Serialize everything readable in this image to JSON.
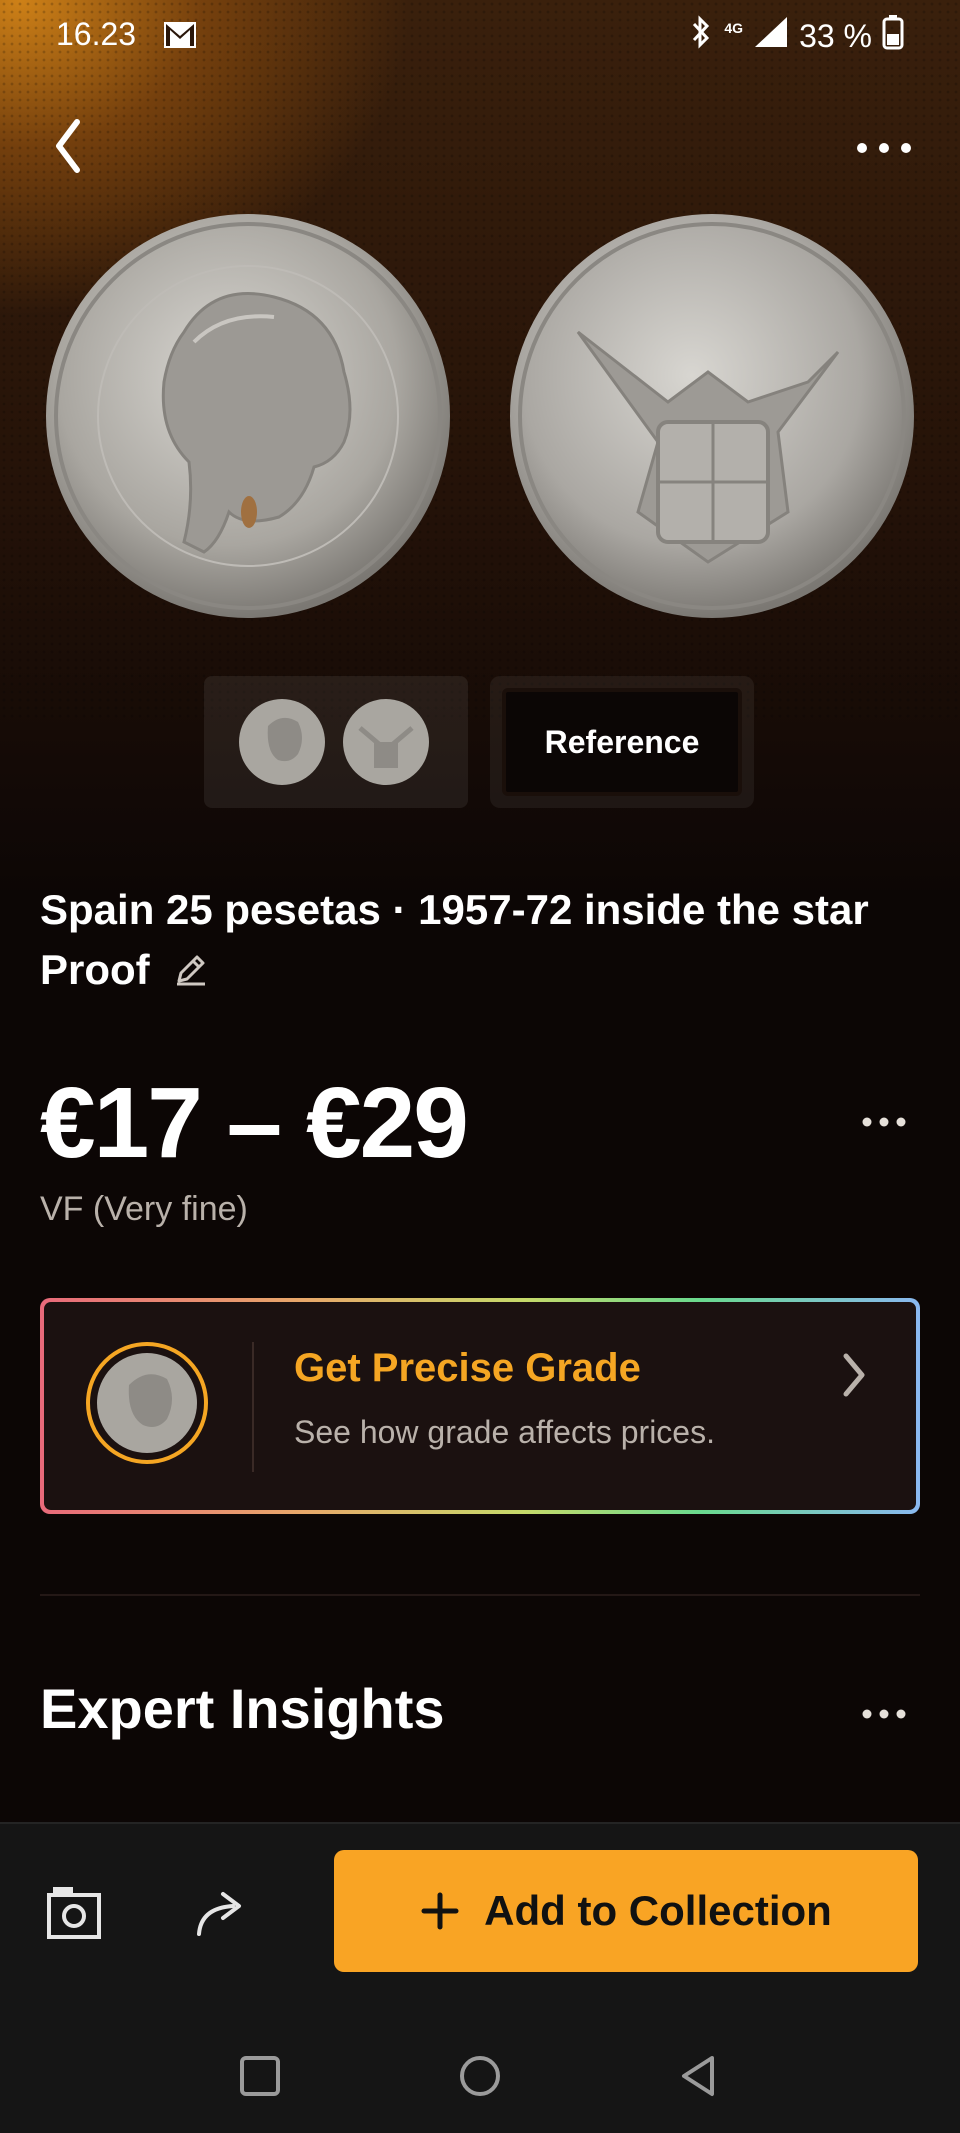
{
  "status_bar": {
    "time": "16.23",
    "network": "4G",
    "battery": "33 %"
  },
  "icons": {
    "back": "chevron-left-icon",
    "more": "more-horizontal-icon",
    "edit": "pencil-icon",
    "camera": "camera-icon",
    "share": "share-icon",
    "add": "plus-icon"
  },
  "gallery": {
    "reference_label": "Reference"
  },
  "coin": {
    "title": "Spain 25 pesetas · 1957-72 inside the star Proof",
    "price_range": "€17 – €29",
    "grade": "VF (Very fine)"
  },
  "grade_card": {
    "title": "Get Precise Grade",
    "subtitle": "See how grade affects prices."
  },
  "insights": {
    "title": "Expert Insights"
  },
  "actions": {
    "add_label": "Add to Collection"
  },
  "colors": {
    "accent": "#f9a424",
    "background": "#0c0605",
    "muted_text": "#b9b1aa"
  }
}
